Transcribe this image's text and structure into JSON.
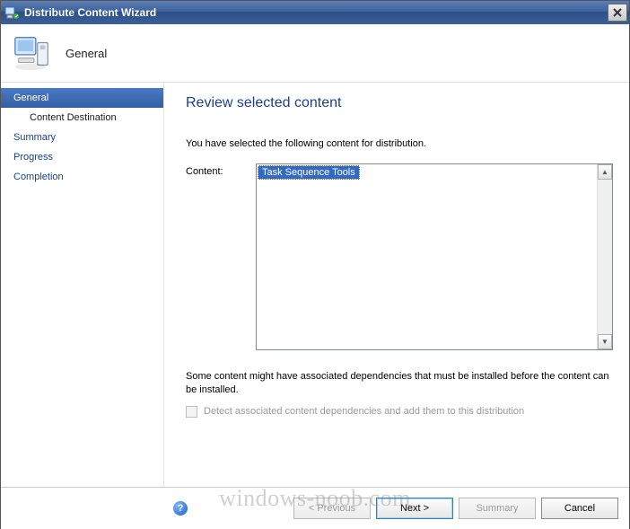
{
  "window": {
    "title": "Distribute Content Wizard"
  },
  "header": {
    "title": "General"
  },
  "sidebar": {
    "items": [
      {
        "label": "General",
        "active": true
      },
      {
        "label": "Content Destination",
        "sub": true
      },
      {
        "label": "Summary"
      },
      {
        "label": "Progress"
      },
      {
        "label": "Completion"
      }
    ]
  },
  "page": {
    "heading": "Review selected content",
    "intro": "You have selected the following content for distribution.",
    "content_label": "Content:",
    "content_items": [
      "Task Sequence Tools"
    ],
    "note": "Some content might have associated dependencies that must be installed before the content can be installed.",
    "checkbox_label": "Detect associated content dependencies and add them to this distribution"
  },
  "footer": {
    "previous": "< Previous",
    "next": "Next >",
    "summary": "Summary",
    "cancel": "Cancel"
  },
  "watermark": "windows-noob.com"
}
